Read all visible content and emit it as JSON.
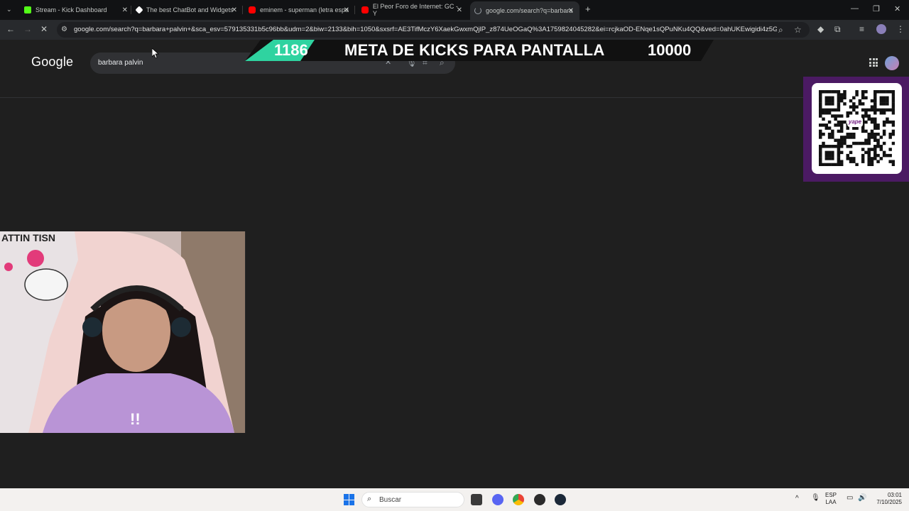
{
  "tabs": [
    {
      "title": "Stream - Kick Dashboard",
      "icon": "kick-icon",
      "color": "#53fc18"
    },
    {
      "title": "The best ChatBot and Widgets",
      "icon": "botrix-icon",
      "color": "#ffffff"
    },
    {
      "title": "eminem - superman (letra espa",
      "icon": "youtube-icon",
      "color": "#ff0000"
    },
    {
      "title": "El Peor Foro de Internet: GC - Y",
      "icon": "youtube-icon",
      "color": "#ff0000"
    },
    {
      "title": "google.com/search?q=barbara",
      "icon": "loading-icon",
      "color": "#9aa0a6"
    }
  ],
  "address_bar": {
    "url": "google.com/search?q=barbara+palvin+&sca_esv=579135331b5c96bb&udm=2&biw=2133&bih=1050&sxsrf=AE3TifMczY6XaekGwxmQjlP_z874UeOGaQ%3A1759824045282&ei=rcjkaOD-ENqe1sQPuNKu4QQ&ved=0ahUKEwigidi4z5GQA..."
  },
  "google": {
    "logo": "Google",
    "query": "barbara palvin"
  },
  "overlay": {
    "kick_count": "1186",
    "title": "META DE KICKS PARA PANTALLA",
    "goal": "10000",
    "qr_brand": "yape"
  },
  "taskbar": {
    "search_label": "Buscar",
    "lang_top": "ESP",
    "lang_bottom": "LAA",
    "time": "03:01",
    "date": "7/10/2025"
  },
  "colors": {
    "accent_teal": "#2fd3a0",
    "qr_purple": "#4b1a63",
    "yape_purple": "#742284"
  }
}
